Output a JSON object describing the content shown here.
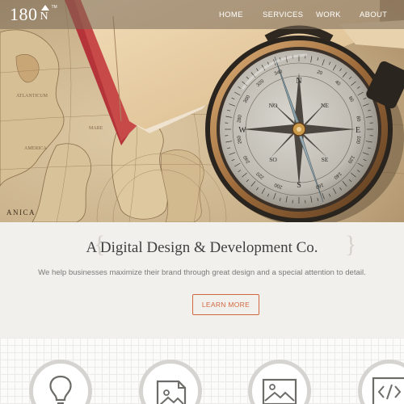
{
  "brand": {
    "logo_number": "180",
    "logo_letter": "N",
    "logo_tm": "TM"
  },
  "nav": {
    "items": [
      {
        "label": "HOME"
      },
      {
        "label": "SERVICES"
      },
      {
        "label": "WORK"
      },
      {
        "label": "ABOUT"
      }
    ]
  },
  "hero": {
    "map_labels": [
      "ANICA"
    ],
    "compass_letters": {
      "n": "N",
      "s": "S",
      "e": "E",
      "w": "W",
      "ne": "NE",
      "no": "NO",
      "so": "SO",
      "se": "SE"
    },
    "compass_degrees": [
      "320",
      "340",
      "20",
      "40",
      "60",
      "80",
      "100",
      "120",
      "140",
      "160",
      "300",
      "280",
      "260",
      "240",
      "220",
      "200"
    ]
  },
  "tagline": {
    "brace_open": "{",
    "headline": "A Digital Design & Development Co.",
    "brace_close": "}",
    "subline": "We help businesses maximize their brand through great design and a special attention to detail.",
    "cta_label": "LEARN MORE"
  },
  "colors": {
    "accent": "#d0683f",
    "nav_text": "#ffffff",
    "heading": "#3f3f3f",
    "body": "#7c7a78"
  },
  "services": {
    "icons": [
      "lightbulb-icon",
      "image-document-icon",
      "image-frame-icon",
      "code-icon"
    ]
  }
}
